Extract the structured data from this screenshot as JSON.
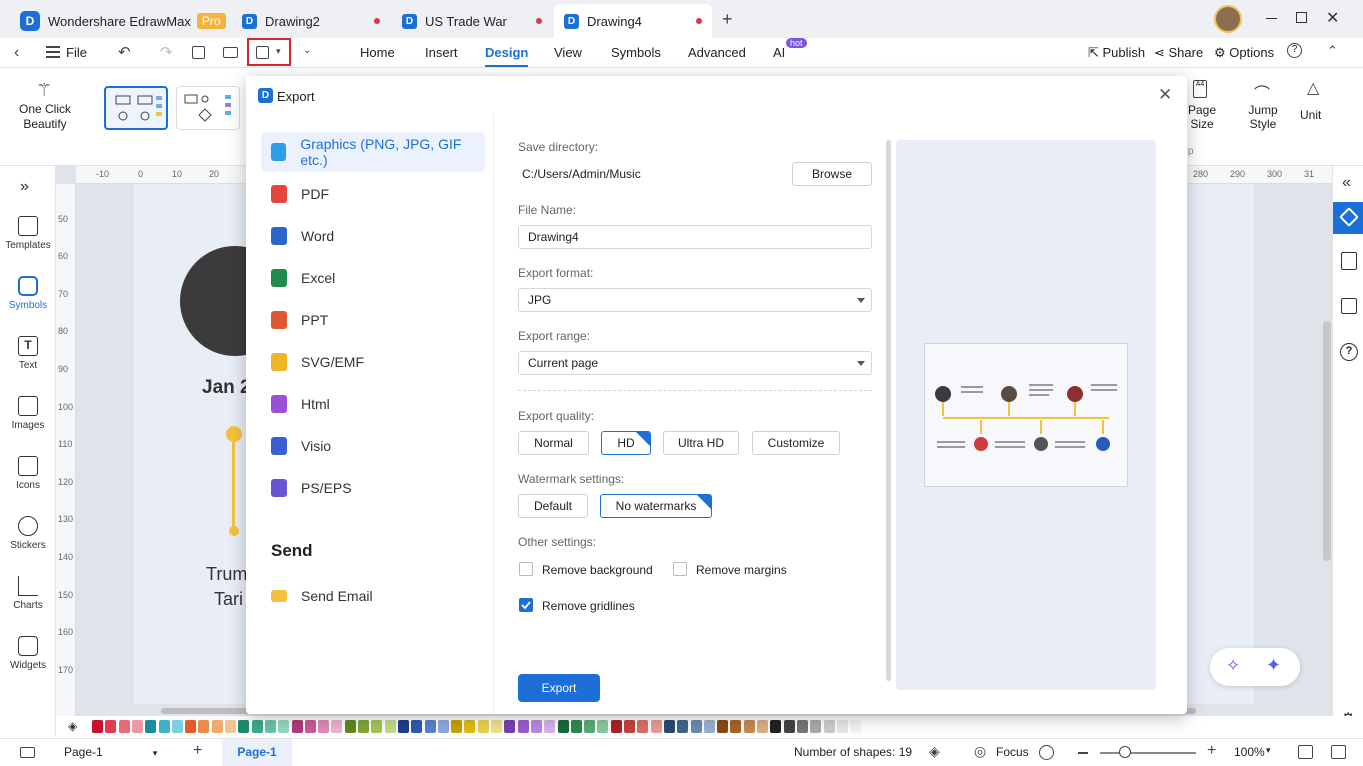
{
  "titlebar": {
    "app_name": "Wondershare EdrawMax",
    "pro_badge": "Pro",
    "tabs": [
      {
        "label": "Drawing2"
      },
      {
        "label": "US Trade War"
      },
      {
        "label": "Drawing4"
      }
    ],
    "add_tab": "+"
  },
  "menubar": {
    "file": "File",
    "tabs": [
      "Home",
      "Insert",
      "Design",
      "View",
      "Symbols",
      "Advanced",
      "AI"
    ],
    "hot_badge": "hot",
    "publish": "Publish",
    "share": "Share",
    "options": "Options"
  },
  "ribbon": {
    "one_click_beautify": "One Click Beautify",
    "page_size": "Page Size",
    "jump_style": "Jump Style",
    "unit": "Unit",
    "section_letter": "p"
  },
  "left_sidebar": {
    "items": [
      "Templates",
      "Symbols",
      "Text",
      "Images",
      "Icons",
      "Stickers",
      "Charts",
      "Widgets"
    ]
  },
  "ruler": {
    "h_ticks": [
      "-10",
      "0",
      "10",
      "20",
      "280",
      "290",
      "300",
      "31"
    ],
    "v_ticks": [
      "50",
      "60",
      "70",
      "80",
      "90",
      "100",
      "110",
      "120",
      "130",
      "140",
      "150",
      "160",
      "170"
    ]
  },
  "canvas": {
    "date_text": "Jan 2",
    "caption_line1": "Trum",
    "caption_line2": "Tari"
  },
  "dialog": {
    "title": "Export",
    "formats": [
      {
        "label": "Graphics (PNG, JPG, GIF etc.)",
        "icon": "image-file-icon",
        "color": "#2f9ee8"
      },
      {
        "label": "PDF",
        "icon": "pdf-file-icon",
        "color": "#e5473c"
      },
      {
        "label": "Word",
        "icon": "word-file-icon",
        "color": "#2b66c9"
      },
      {
        "label": "Excel",
        "icon": "excel-file-icon",
        "color": "#1f8b4c"
      },
      {
        "label": "PPT",
        "icon": "ppt-file-icon",
        "color": "#e0582f"
      },
      {
        "label": "SVG/EMF",
        "icon": "svg-file-icon",
        "color": "#f0b429"
      },
      {
        "label": "Html",
        "icon": "html-file-icon",
        "color": "#9b4fd8"
      },
      {
        "label": "Visio",
        "icon": "visio-file-icon",
        "color": "#3a5fd0"
      },
      {
        "label": "PS/EPS",
        "icon": "eps-file-icon",
        "color": "#6a54d6"
      }
    ],
    "send_heading": "Send",
    "send_email": "Send Email",
    "save_directory_label": "Save directory:",
    "save_directory_value": "C:/Users/Admin/Music",
    "browse": "Browse",
    "file_name_label": "File Name:",
    "file_name_value": "Drawing4",
    "export_format_label": "Export format:",
    "export_format_value": "JPG",
    "export_range_label": "Export range:",
    "export_range_value": "Current page",
    "export_quality_label": "Export quality:",
    "quality_options": [
      "Normal",
      "HD",
      "Ultra HD",
      "Customize"
    ],
    "quality_selected": "HD",
    "watermark_label": "Watermark settings:",
    "watermark_options": [
      "Default",
      "No watermarks"
    ],
    "watermark_selected": "No watermarks",
    "other_settings_label": "Other settings:",
    "remove_background": "Remove background",
    "remove_background_checked": false,
    "remove_margins": "Remove margins",
    "remove_margins_checked": false,
    "remove_gridlines": "Remove gridlines",
    "remove_gridlines_checked": true,
    "export_button": "Export"
  },
  "statusbar": {
    "page_select": "Page-1",
    "active_page": "Page-1",
    "shapes": "Number of shapes: 19",
    "focus": "Focus",
    "zoom": "100%"
  },
  "colors": {
    "accent": "#1d6fd8",
    "highlight_box": "#d8262c",
    "timeline_yellow": "#f3c23d"
  }
}
